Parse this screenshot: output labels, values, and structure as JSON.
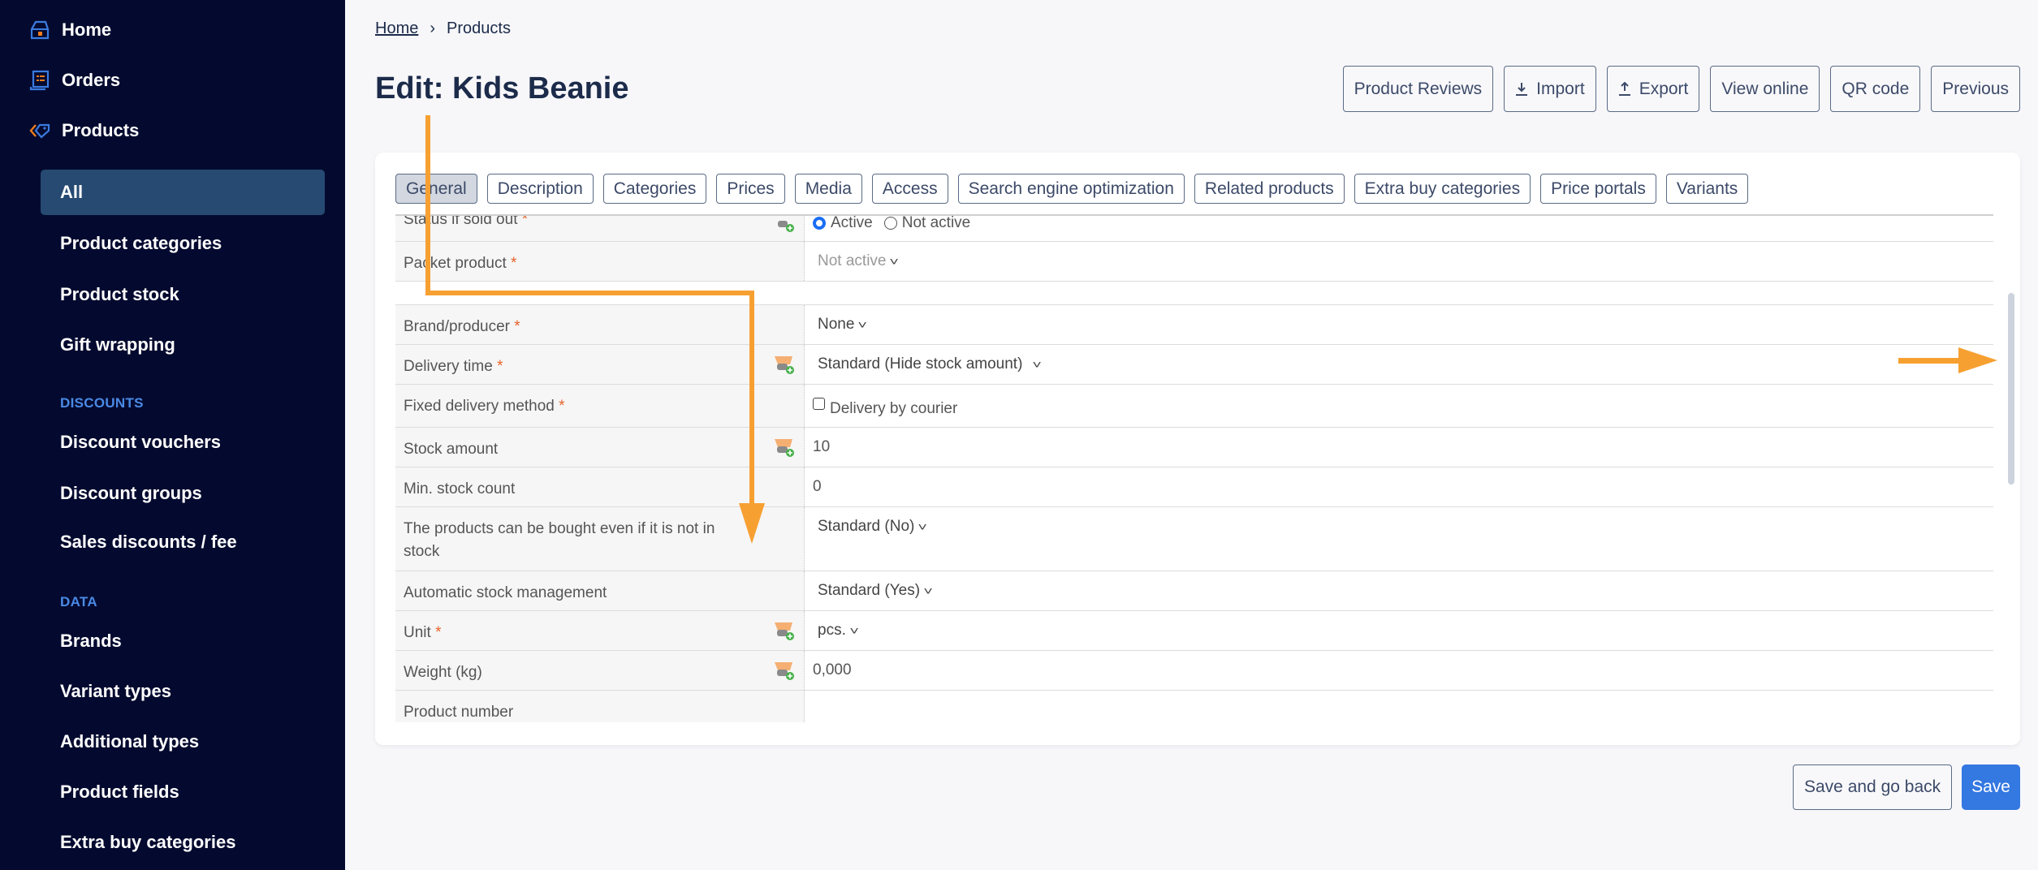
{
  "sidebar": {
    "top_items": [
      {
        "label": "Home",
        "icon": "home-icon"
      },
      {
        "label": "Orders",
        "icon": "orders-icon"
      },
      {
        "label": "Products",
        "icon": "tag-icon"
      }
    ],
    "products_sub": [
      "All",
      "Product categories",
      "Product stock",
      "Gift wrapping"
    ],
    "active_sub": "All",
    "sections": [
      {
        "title": "DISCOUNTS",
        "items": [
          "Discount vouchers",
          "Discount groups",
          "Sales discounts / fee"
        ]
      },
      {
        "title": "DATA",
        "items": [
          "Brands",
          "Variant types",
          "Additional types",
          "Product fields",
          "Extra buy categories"
        ]
      }
    ]
  },
  "breadcrumb": {
    "home": "Home",
    "separator": "›",
    "current": "Products"
  },
  "page_title": "Edit: Kids Beanie",
  "top_actions": [
    {
      "label": "Product Reviews",
      "icon": null
    },
    {
      "label": "Import",
      "icon": "import-icon"
    },
    {
      "label": "Export",
      "icon": "export-icon"
    },
    {
      "label": "View online",
      "icon": null
    },
    {
      "label": "QR code",
      "icon": null
    },
    {
      "label": "Previous",
      "icon": null
    }
  ],
  "tabs": [
    "General",
    "Description",
    "Categories",
    "Prices",
    "Media",
    "Access",
    "Search engine optimization",
    "Related products",
    "Extra buy categories",
    "Price portals",
    "Variants"
  ],
  "active_tab": "General",
  "form": {
    "status_if_sold_out": {
      "label": "Status if sold out",
      "required": "*",
      "options": [
        "Active",
        "Not active"
      ],
      "selected": "Active"
    },
    "packet_product": {
      "label": "Packet product",
      "required": "*",
      "value": "Not active"
    },
    "brand": {
      "label": "Brand/producer",
      "required": "*",
      "value": "None"
    },
    "delivery_time": {
      "label": "Delivery time",
      "required": "*",
      "value": "Standard (Hide stock amount)"
    },
    "fixed_delivery": {
      "label": "Fixed delivery method",
      "required": "*",
      "checkbox_label": "Delivery by courier",
      "checked": false
    },
    "stock_amount": {
      "label": "Stock amount",
      "value": "10"
    },
    "min_stock": {
      "label": "Min. stock count",
      "value": "0"
    },
    "buy_not_in_stock": {
      "label": "The products can be bought even if it is not in stock",
      "value": "Standard (No)"
    },
    "auto_stock": {
      "label": "Automatic stock management",
      "value": "Standard (Yes)"
    },
    "unit": {
      "label": "Unit",
      "required": "*",
      "value": "pcs."
    },
    "weight": {
      "label": "Weight (kg)",
      "value": "0,000"
    },
    "product_number": {
      "label": "Product number",
      "value": ""
    }
  },
  "bottom_actions": {
    "save_back": "Save and go back",
    "save": "Save"
  },
  "colors": {
    "sidebar_bg": "#040a2f",
    "active_nav": "#264a72",
    "primary": "#3478e1",
    "annotation": "#f7a032",
    "required": "#e8632b"
  }
}
